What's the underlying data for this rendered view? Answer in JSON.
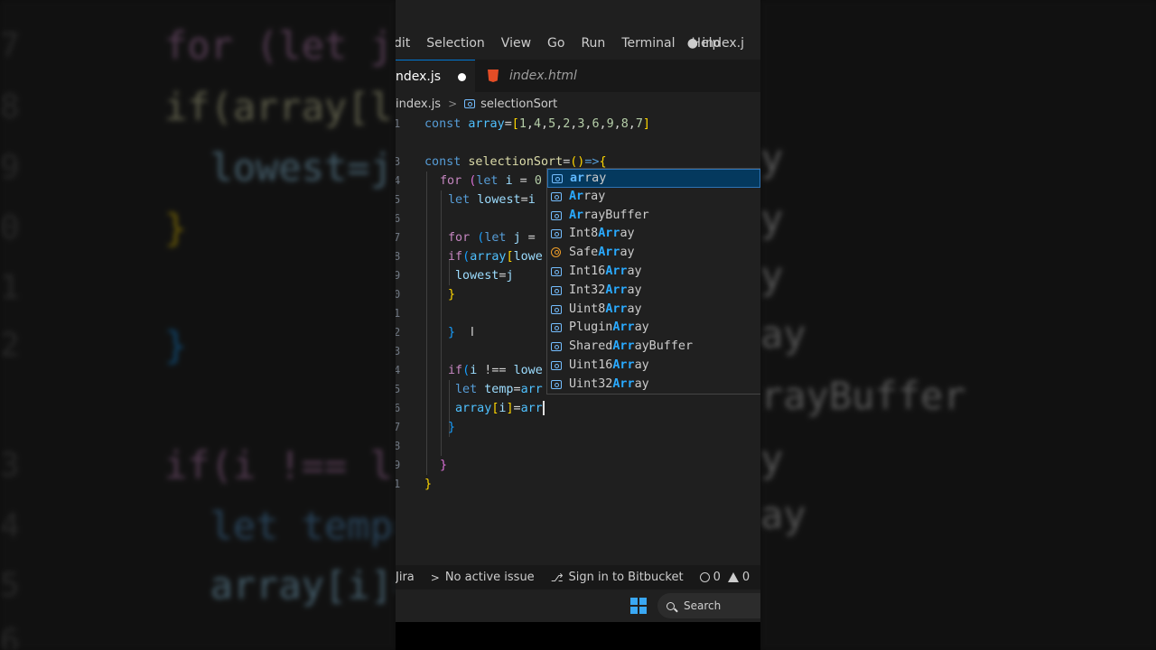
{
  "menu": {
    "items": [
      "dit",
      "Selection",
      "View",
      "Go",
      "Run",
      "Terminal",
      "Help"
    ],
    "dirty_file": "● index.j"
  },
  "tabs": [
    {
      "label": "ndex.js",
      "modified": true
    },
    {
      "label": "index.html"
    }
  ],
  "breadcrumb": {
    "file": "index.js",
    "symbol": "selectionSort"
  },
  "gutter_digits": [
    "1",
    "",
    "3",
    "4",
    "5",
    "6",
    "7",
    "8",
    "9",
    "0",
    "1",
    "2",
    "3",
    "4",
    "5",
    "6",
    "7",
    "8",
    "9",
    "1"
  ],
  "suggestions": [
    {
      "pre": "",
      "match": "ar",
      "rest": "ray",
      "kind": "variable"
    },
    {
      "pre": "",
      "match": "Ar",
      "rest": "ray",
      "kind": "variable"
    },
    {
      "pre": "",
      "match": "Ar",
      "rest": "rayBuffer",
      "kind": "variable"
    },
    {
      "pre": "Int8",
      "match": "Arr",
      "rest": "ay",
      "kind": "variable"
    },
    {
      "pre": "Safe",
      "match": "Arr",
      "rest": "ay",
      "kind": "class"
    },
    {
      "pre": "Int16",
      "match": "Arr",
      "rest": "ay",
      "kind": "variable"
    },
    {
      "pre": "Int32",
      "match": "Arr",
      "rest": "ay",
      "kind": "variable"
    },
    {
      "pre": "Uint8",
      "match": "Arr",
      "rest": "ay",
      "kind": "variable"
    },
    {
      "pre": "Plugin",
      "match": "Arr",
      "rest": "ay",
      "kind": "variable"
    },
    {
      "pre": "Shared",
      "match": "Arr",
      "rest": "ayBuffer",
      "kind": "variable"
    },
    {
      "pre": "Uint16",
      "match": "Arr",
      "rest": "ay",
      "kind": "variable"
    },
    {
      "pre": "Uint32",
      "match": "Arr",
      "rest": "ay",
      "kind": "variable"
    }
  ],
  "status": {
    "jira": "Jira",
    "issue": "No active issue",
    "bitbucket": "Sign in to Bitbucket",
    "errors": "0",
    "warnings": "0"
  },
  "taskbar": {
    "search": "Search"
  },
  "background": {
    "left_lines": [
      "for (let j",
      "if(array[l",
      "  lowest=j",
      "}",
      "}",
      "if(i !== l",
      "  let temp=",
      "  array[i]="
    ],
    "left_gutter": [
      "7",
      "8",
      "9",
      "0",
      "1",
      "2",
      "3",
      "4",
      "5",
      "6"
    ],
    "right_lines": [
      "y",
      "y",
      "y",
      "y",
      "ay",
      "rayBuffer",
      "ay",
      "ay"
    ]
  },
  "colors": {
    "accent": "#0078d4",
    "editor_bg": "#1f1f1f",
    "selection": "#04395e"
  }
}
